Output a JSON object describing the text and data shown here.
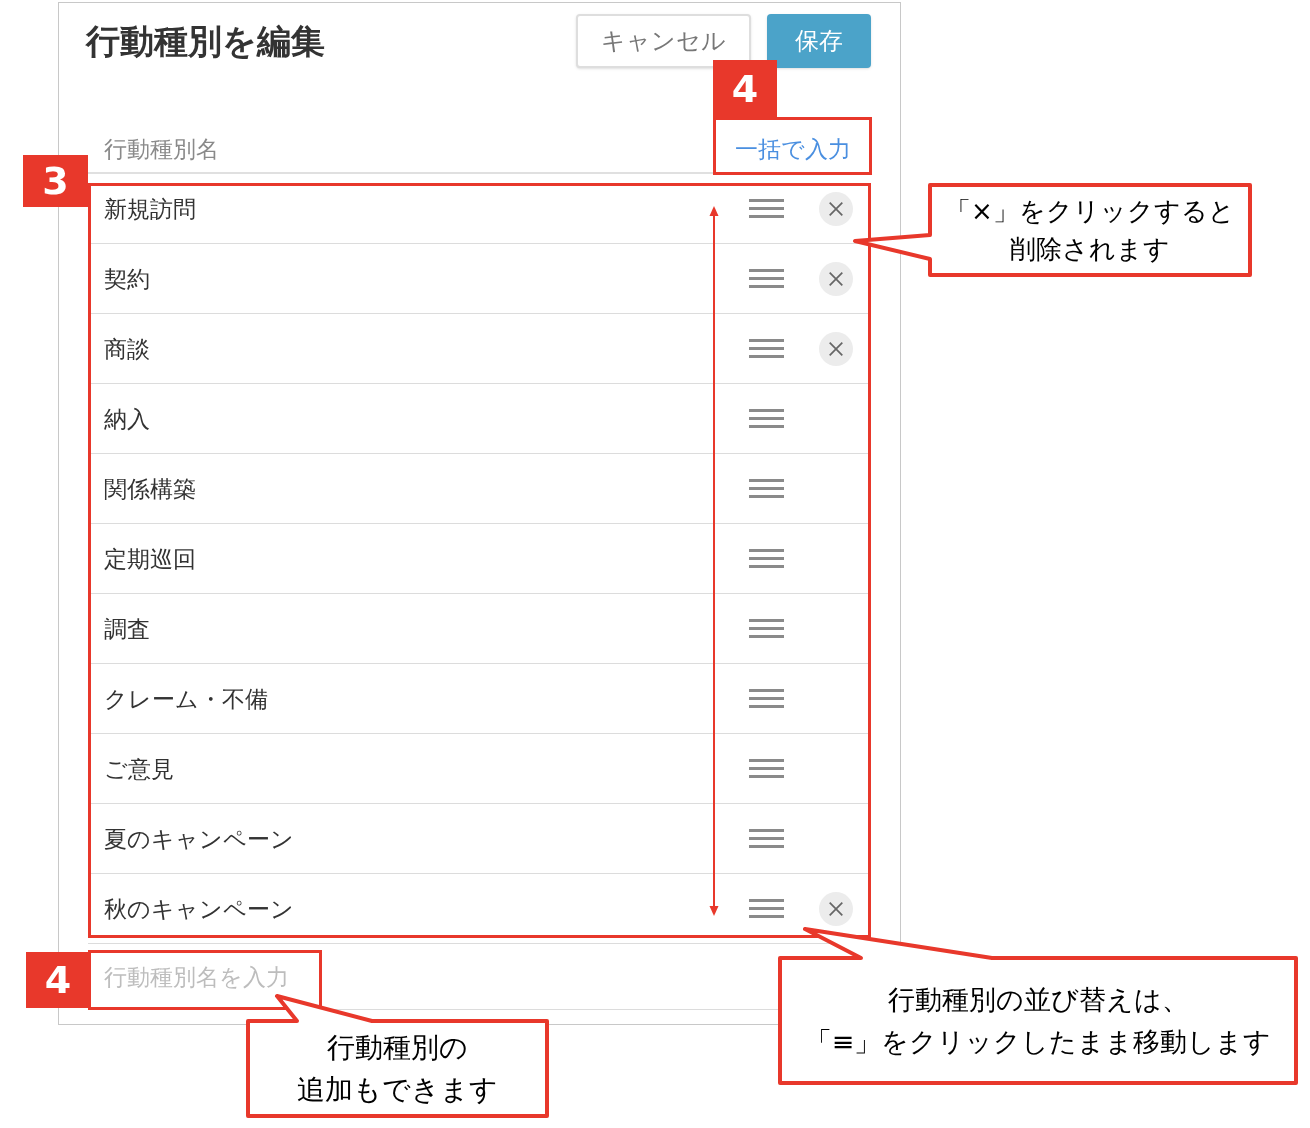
{
  "dialog": {
    "title": "行動種別を編集",
    "buttons": [
      {
        "label": "キャンセル",
        "kind": "secondary"
      },
      {
        "label": "保存",
        "kind": "primary"
      }
    ],
    "column_header": "行動種別名",
    "bulk_input_link": "一括で入力",
    "rows": [
      {
        "name": "新規訪問",
        "removable": true
      },
      {
        "name": "契約",
        "removable": true
      },
      {
        "name": "商談",
        "removable": true
      },
      {
        "name": "納入",
        "removable": false
      },
      {
        "name": "関係構築",
        "removable": false
      },
      {
        "name": "定期巡回",
        "removable": false
      },
      {
        "name": "調査",
        "removable": false
      },
      {
        "name": "クレーム・不備",
        "removable": false
      },
      {
        "name": "ご意見",
        "removable": false
      },
      {
        "name": "夏のキャンペーン",
        "removable": false
      },
      {
        "name": "秋のキャンペーン",
        "removable": true
      }
    ],
    "new_type_input": {
      "placeholder": "行動種別名を入力"
    }
  },
  "annotations": {
    "step_markers": [
      {
        "number": "4"
      },
      {
        "number": "3"
      },
      {
        "number": "4"
      }
    ],
    "callouts": [
      {
        "lines": [
          "「×」をクリックすると",
          "削除されます"
        ]
      },
      {
        "lines": [
          "行動種別の並び替えは、",
          "「≡」をクリックしたまま移動します"
        ]
      },
      {
        "lines": [
          "行動種別の",
          "追加もできます"
        ]
      }
    ]
  }
}
